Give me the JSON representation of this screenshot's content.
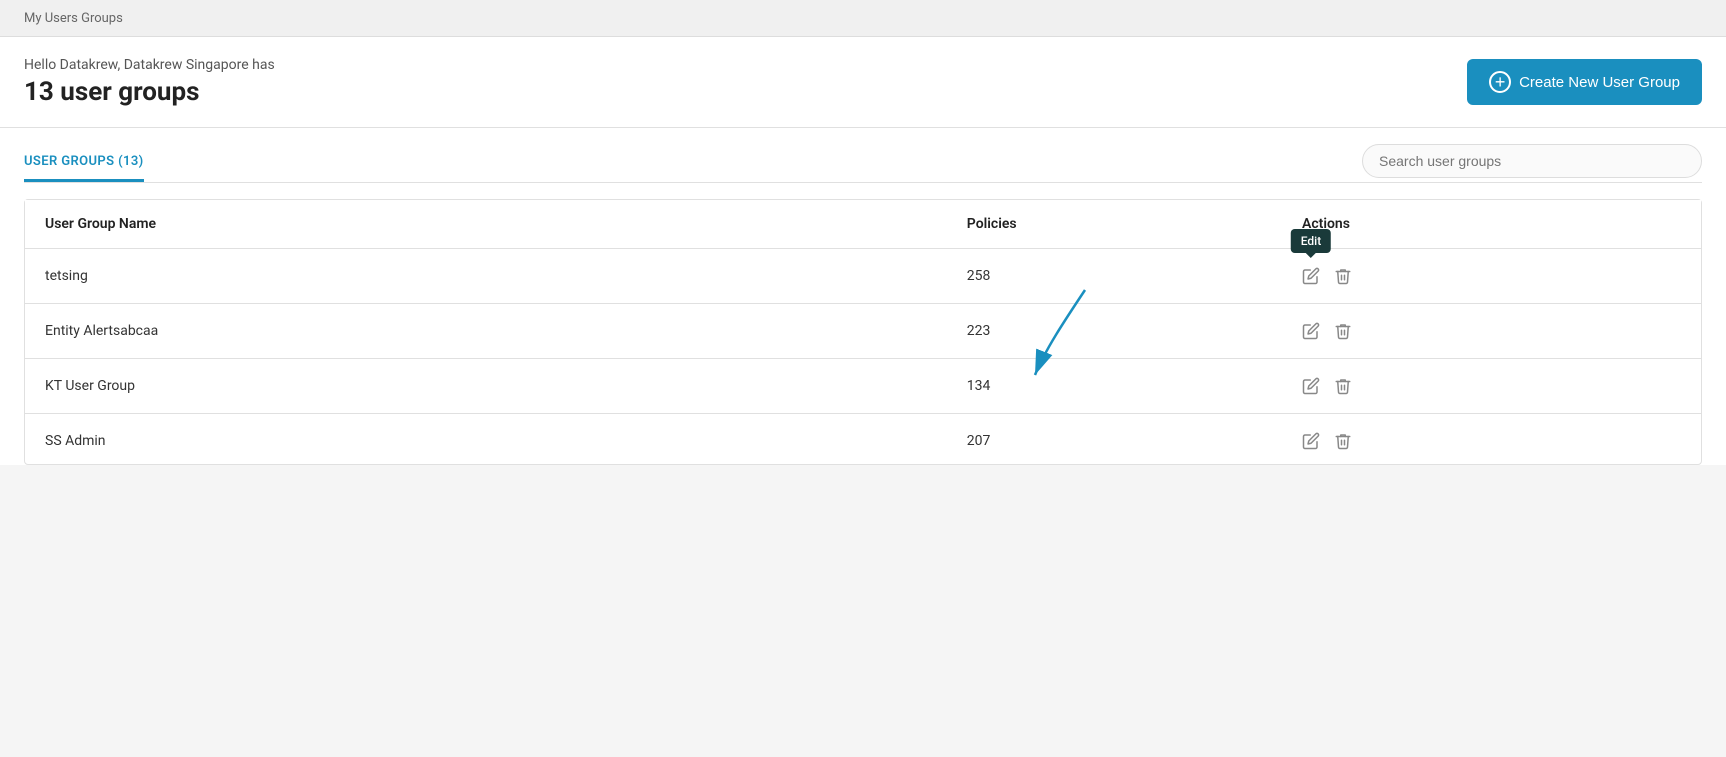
{
  "breadcrumb": {
    "label": "My Users Groups"
  },
  "header": {
    "subtitle": "Hello Datakrew, Datakrew Singapore has",
    "count_label": "13 user groups",
    "create_button_label": "Create New User Group"
  },
  "tabs": [
    {
      "label": "USER GROUPS (13)",
      "active": true
    }
  ],
  "search": {
    "placeholder": "Search user groups"
  },
  "table": {
    "columns": [
      "User Group Name",
      "Policies",
      "Actions"
    ],
    "rows": [
      {
        "name": "tetsing",
        "policies": "258",
        "edit_tooltip": "Edit"
      },
      {
        "name": "Entity Alertsabcaa",
        "policies": "223",
        "edit_tooltip": ""
      },
      {
        "name": "KT User Group",
        "policies": "134",
        "edit_tooltip": ""
      },
      {
        "name": "SS Admin",
        "policies": "207",
        "edit_tooltip": ""
      }
    ]
  },
  "tooltip": {
    "edit_label": "Edit"
  },
  "icons": {
    "edit": "✏",
    "delete": "🗑",
    "plus": "+"
  }
}
